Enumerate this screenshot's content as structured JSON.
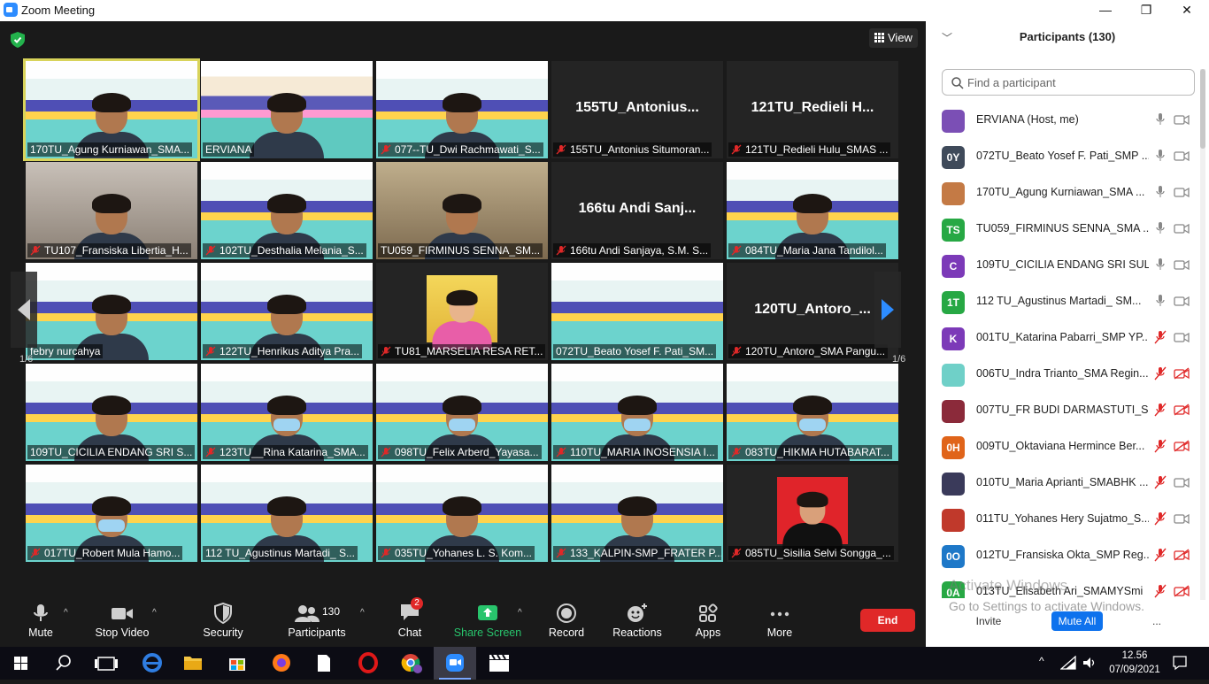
{
  "window": {
    "title": "Zoom Meeting",
    "minimize": "—",
    "restore": "❐",
    "close": "✕"
  },
  "meeting": {
    "view_label": "View",
    "page_left": "1/6",
    "page_right": "1/6",
    "tiles": [
      {
        "label": "170TU_Agung Kurniawan_SMA...",
        "muted": false,
        "bg": "banner",
        "video": true,
        "active": true
      },
      {
        "label": "ERVIANA",
        "muted": false,
        "bg": "banner2",
        "video": true
      },
      {
        "label": "077--TU_Dwi Rachmawati_S...",
        "muted": true,
        "bg": "banner",
        "video": true
      },
      {
        "label": "155TU_Antonius Situmoran...",
        "muted": true,
        "bg": "dark",
        "big": "155TU_Antonius..."
      },
      {
        "label": "121TU_Redieli Hulu_SMAS ...",
        "muted": true,
        "bg": "dark",
        "big": "121TU_Redieli  H..."
      },
      {
        "label": "TU107_Fransiska Libertia_H...",
        "muted": true,
        "bg": "room",
        "video": true
      },
      {
        "label": "102TU_Desthalia Melania_S...",
        "muted": true,
        "bg": "banner",
        "video": true
      },
      {
        "label": "TU059_FIRMINUS SENNA_SM...",
        "muted": false,
        "bg": "wall",
        "video": true
      },
      {
        "label": "166tu Andi Sanjaya, S.M. S...",
        "muted": true,
        "bg": "dark",
        "big": "166tu  Andi Sanj..."
      },
      {
        "label": "084TU_Maria Jana Tandilol...",
        "muted": true,
        "bg": "banner",
        "video": true
      },
      {
        "label": "febry nurcahya",
        "muted": false,
        "bg": "banner",
        "video": true
      },
      {
        "label": "122TU_Henrikus Aditya Pra...",
        "muted": true,
        "bg": "banner",
        "video": true
      },
      {
        "label": "TU81_MARSELIA RESA RET...",
        "muted": true,
        "bg": "dark",
        "photo": true
      },
      {
        "label": "072TU_Beato Yosef F. Pati_SM...",
        "muted": false,
        "bg": "banner",
        "video": false
      },
      {
        "label": "120TU_Antoro_SMA Pangu...",
        "muted": true,
        "bg": "dark",
        "big": "120TU_Antoro_..."
      },
      {
        "label": "109TU_CICILIA ENDANG SRI S...",
        "muted": false,
        "bg": "banner",
        "video": true
      },
      {
        "label": "123TU__Rina Katarina_SMA...",
        "muted": true,
        "bg": "banner",
        "video": true,
        "mask": true
      },
      {
        "label": "098TU_Felix Arberd_Yayasa...",
        "muted": true,
        "bg": "banner",
        "video": true,
        "mask": true
      },
      {
        "label": "110TU_MARIA INOSENSIA I...",
        "muted": true,
        "bg": "banner",
        "video": true,
        "mask": true
      },
      {
        "label": "083TU_HIKMA HUTABARAT...",
        "muted": true,
        "bg": "banner",
        "video": true,
        "mask": true
      },
      {
        "label": "017TU_Robert Mula Hamo...",
        "muted": true,
        "bg": "banner",
        "video": true,
        "mask": true
      },
      {
        "label": "112 TU_Agustinus Martadi_ S...",
        "muted": false,
        "bg": "banner",
        "video": true
      },
      {
        "label": "035TU_Yohanes L. S. Kom...",
        "muted": true,
        "bg": "banner",
        "video": true
      },
      {
        "label": "133_KALPIN-SMP_FRATER P...",
        "muted": true,
        "bg": "banner",
        "video": true
      },
      {
        "label": "085TU_Sisilia Selvi Songga_...",
        "muted": true,
        "bg": "dark",
        "redphoto": true
      }
    ]
  },
  "toolbar": {
    "mute": "Mute",
    "stop_video": "Stop Video",
    "security": "Security",
    "participants": "Participants",
    "participants_count": "130",
    "chat": "Chat",
    "chat_badge": "2",
    "share_screen": "Share Screen",
    "record": "Record",
    "reactions": "Reactions",
    "apps": "Apps",
    "more": "More",
    "end": "End"
  },
  "panel": {
    "title": "Participants (130)",
    "search_placeholder": "Find a participant",
    "participants": [
      {
        "name": "ERVIANA (Host, me)",
        "initials": "",
        "color": "#7b4fb5",
        "mic_muted": false,
        "cam_off": false
      },
      {
        "name": "072TU_Beato Yosef F. Pati_SMP ...",
        "initials": "0Y",
        "color": "#3f4a5a",
        "mic_muted": false,
        "cam_off": false
      },
      {
        "name": "170TU_Agung Kurniawan_SMA ...",
        "initials": "",
        "color": "#c47a45",
        "mic_muted": false,
        "cam_off": false
      },
      {
        "name": "TU059_FIRMINUS SENNA_SMA ...",
        "initials": "TS",
        "color": "#27a844",
        "mic_muted": false,
        "cam_off": false
      },
      {
        "name": "109TU_CICILIA ENDANG SRI SUL...",
        "initials": "C",
        "color": "#7c3ab8",
        "mic_muted": false,
        "cam_off": false
      },
      {
        "name": "112 TU_Agustinus Martadi_ SM...",
        "initials": "1T",
        "color": "#27a844",
        "mic_muted": false,
        "cam_off": false
      },
      {
        "name": "001TU_Katarina Pabarri_SMP YP...",
        "initials": "K",
        "color": "#7c3ab8",
        "mic_muted": true,
        "cam_off": false
      },
      {
        "name": "006TU_Indra Trianto_SMA Regin...",
        "initials": "",
        "color": "#6fd0c8",
        "mic_muted": true,
        "cam_off": true
      },
      {
        "name": "007TU_FR BUDI DARMASTUTI_S...",
        "initials": "",
        "color": "#8b2a3a",
        "mic_muted": true,
        "cam_off": true
      },
      {
        "name": "009TU_Oktaviana Hermince Ber...",
        "initials": "0H",
        "color": "#e0641a",
        "mic_muted": true,
        "cam_off": true
      },
      {
        "name": "010TU_Maria Aprianti_SMABHK ...",
        "initials": "",
        "color": "#3a3a5a",
        "mic_muted": true,
        "cam_off": false
      },
      {
        "name": "011TU_Yohanes Hery Sujatmo_S...",
        "initials": "",
        "color": "#c0392b",
        "mic_muted": true,
        "cam_off": false
      },
      {
        "name": "012TU_Fransiska Okta_SMP Reg...",
        "initials": "0O",
        "color": "#1e78c8",
        "mic_muted": true,
        "cam_off": true
      },
      {
        "name": "013TU_Elisabeth Ari_SMAMYSmi",
        "initials": "0A",
        "color": "#27a844",
        "mic_muted": true,
        "cam_off": true
      }
    ],
    "invite": "Invite",
    "mute_all": "Mute All",
    "more": "...",
    "watermark_title": "Activate Windows",
    "watermark_sub": "Go to Settings to activate Windows."
  },
  "taskbar": {
    "time": "12.56",
    "date": "07/09/2021"
  }
}
